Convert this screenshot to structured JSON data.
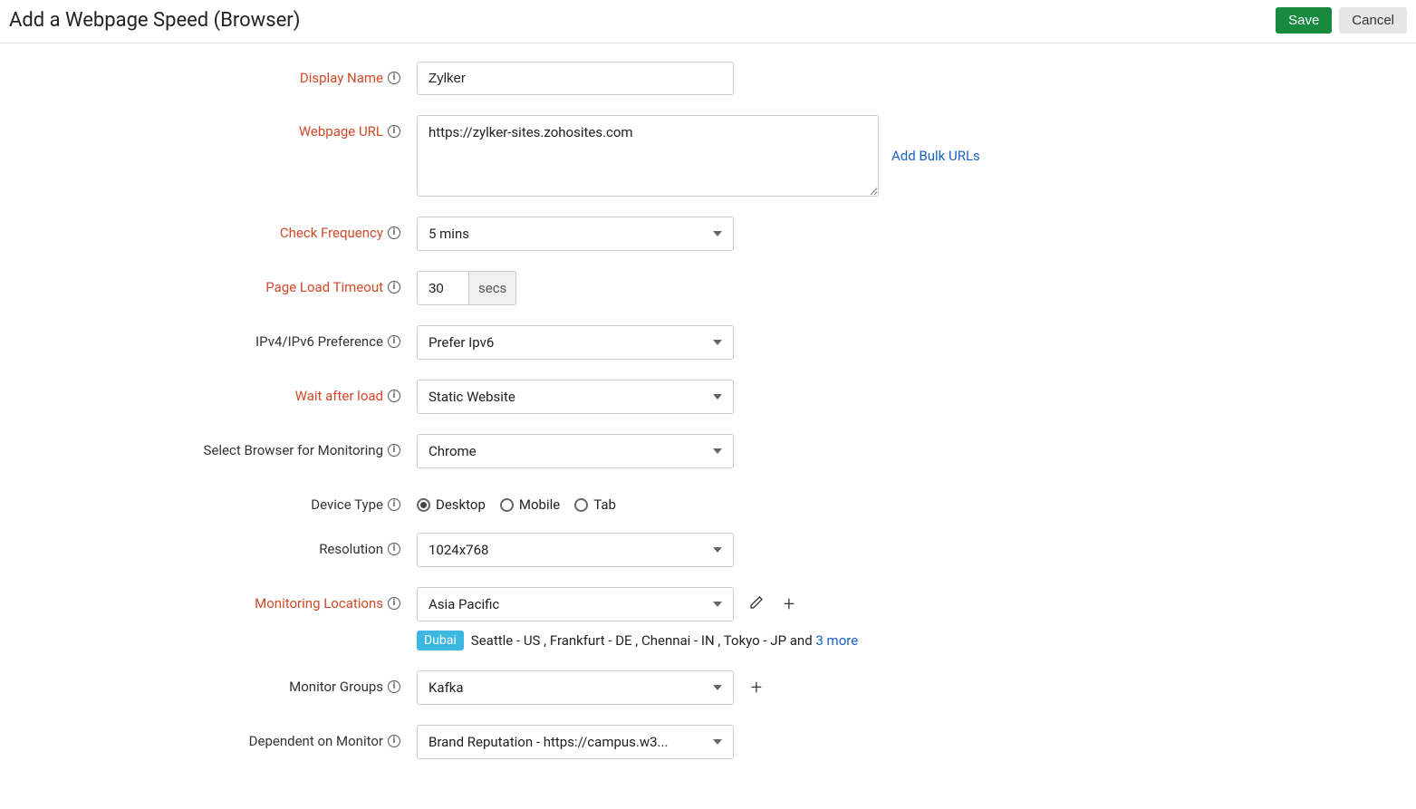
{
  "header": {
    "title": "Add a Webpage Speed (Browser)",
    "save_label": "Save",
    "cancel_label": "Cancel"
  },
  "form": {
    "display_name": {
      "label": "Display Name",
      "value": "Zylker"
    },
    "webpage_url": {
      "label": "Webpage URL",
      "value": "https://zylker-sites.zohosites.com",
      "add_bulk": "Add Bulk URLs"
    },
    "check_frequency": {
      "label": "Check Frequency",
      "value": "5 mins"
    },
    "page_load_timeout": {
      "label": "Page Load Timeout",
      "value": "30",
      "unit": "secs"
    },
    "ip_pref": {
      "label": "IPv4/IPv6 Preference",
      "value": "Prefer Ipv6"
    },
    "wait_after_load": {
      "label": "Wait after load",
      "value": "Static Website"
    },
    "browser": {
      "label": "Select Browser for Monitoring",
      "value": "Chrome"
    },
    "device_type": {
      "label": "Device Type",
      "options": [
        "Desktop",
        "Mobile",
        "Tab"
      ],
      "selected": "Desktop"
    },
    "resolution": {
      "label": "Resolution",
      "value": "1024x768"
    },
    "monitoring_locations": {
      "label": "Monitoring Locations",
      "value": "Asia Pacific",
      "primary_badge": "Dubai",
      "summary": "Seattle - US , Frankfurt - DE , Chennai - IN , Tokyo - JP and ",
      "more_link": "3 more"
    },
    "monitor_groups": {
      "label": "Monitor Groups",
      "value": "Kafka"
    },
    "dependent_on": {
      "label": "Dependent on Monitor",
      "value": "Brand Reputation - https://campus.w3..."
    }
  }
}
